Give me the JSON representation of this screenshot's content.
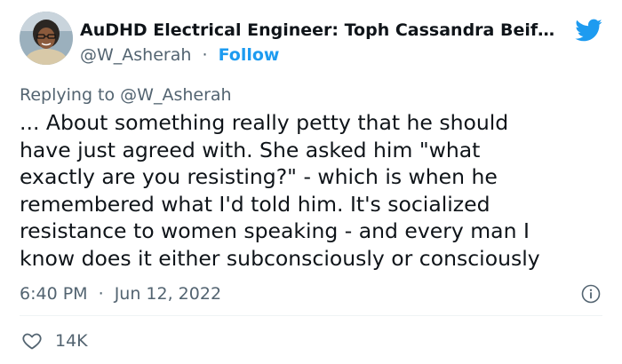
{
  "colors": {
    "brand": "#1d9bf0",
    "text_primary": "#0f1419",
    "text_secondary": "#536471",
    "divider": "#eff3f4"
  },
  "author": {
    "display_name": "AuDHD Electrical Engineer: Toph Cassandra Beif…",
    "handle": "@W_Asherah",
    "separator": "·",
    "follow_label": "Follow",
    "avatar_icon": "profile-photo"
  },
  "brand_icon": "twitter-bird-icon",
  "reply": {
    "prefix": "Replying to",
    "handle": "@W_Asherah"
  },
  "tweet": {
    "lines": [
      "... About something really petty that he should",
      "have just agreed with. She asked him \"what",
      "exactly are you resisting?\" - which is when he",
      "remembered what I'd told him. It's socialized",
      "resistance to women speaking - and every man I",
      "know does it either subconsciously or consciously"
    ]
  },
  "meta": {
    "time": "6:40 PM",
    "separator": "·",
    "date": "Jun 12, 2022",
    "info_icon": "info-icon"
  },
  "engagement": {
    "like_icon": "heart-icon",
    "likes": "14K"
  }
}
